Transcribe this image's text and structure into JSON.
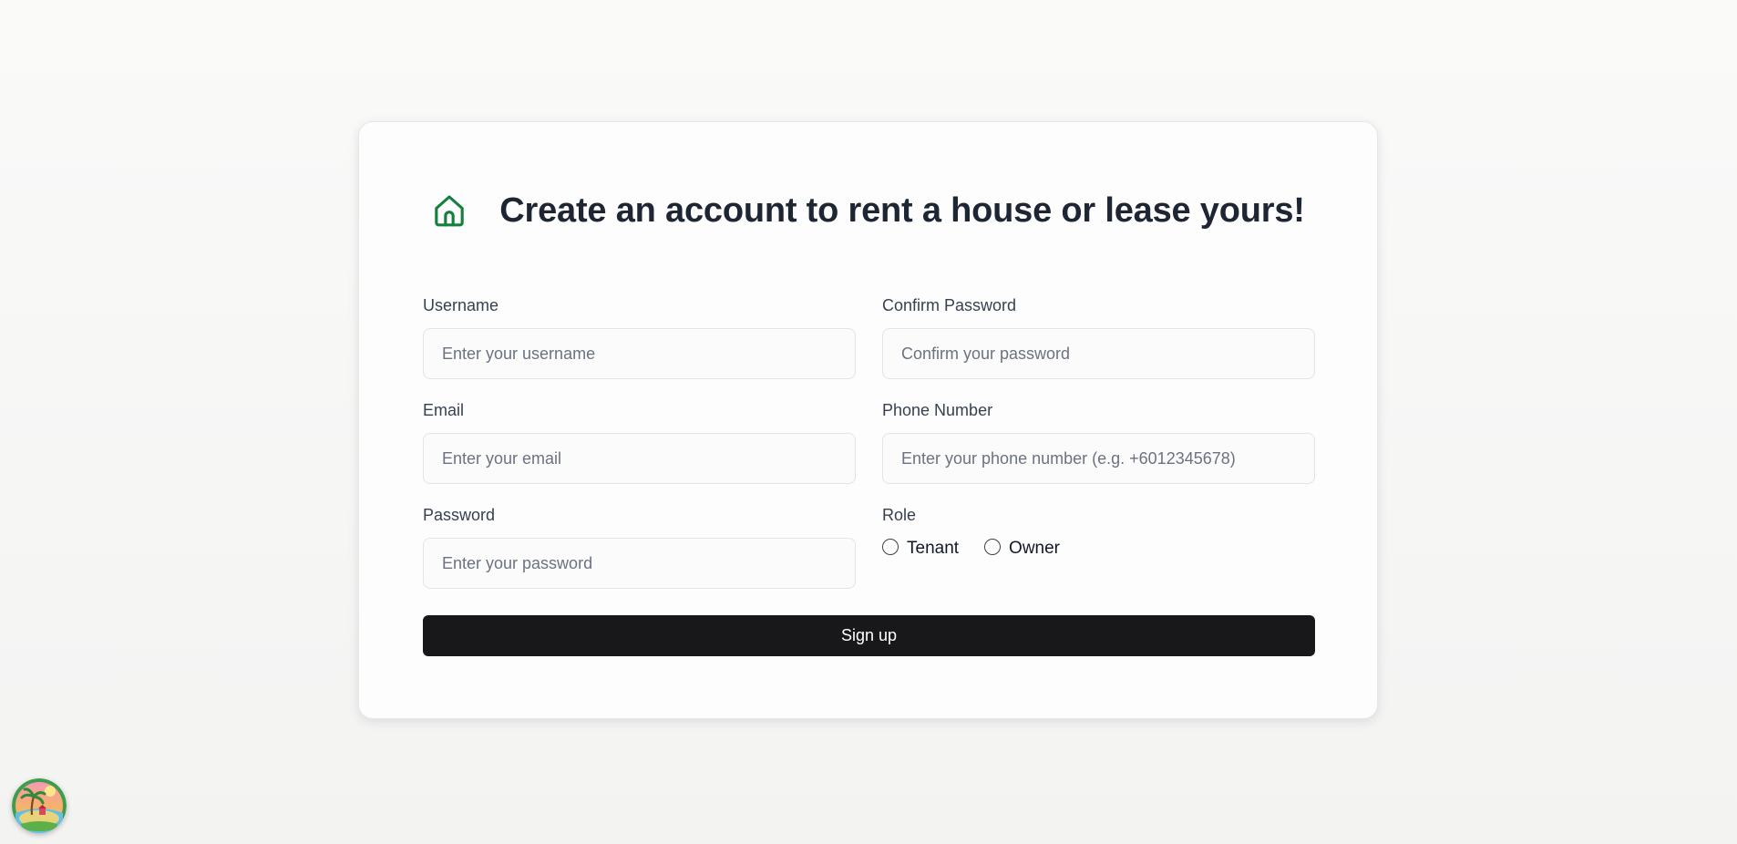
{
  "header": {
    "icon": "home-icon",
    "title": "Create an account to rent a house or lease yours!"
  },
  "form": {
    "username": {
      "label": "Username",
      "placeholder": "Enter your username",
      "value": ""
    },
    "email": {
      "label": "Email",
      "placeholder": "Enter your email",
      "value": ""
    },
    "password": {
      "label": "Password",
      "placeholder": "Enter your password",
      "value": ""
    },
    "confirm_password": {
      "label": "Confirm Password",
      "placeholder": "Confirm your password",
      "value": ""
    },
    "phone": {
      "label": "Phone Number",
      "placeholder": "Enter your phone number (e.g. +6012345678)",
      "value": ""
    },
    "role": {
      "label": "Role",
      "options": [
        {
          "label": "Tenant",
          "selected": false
        },
        {
          "label": "Owner",
          "selected": false
        }
      ]
    },
    "submit_label": "Sign up"
  },
  "floating_button": {
    "icon": "beach-island-icon"
  },
  "colors": {
    "accent_green": "#15803d",
    "button_bg": "#18181a",
    "title_text": "#1e2533"
  }
}
